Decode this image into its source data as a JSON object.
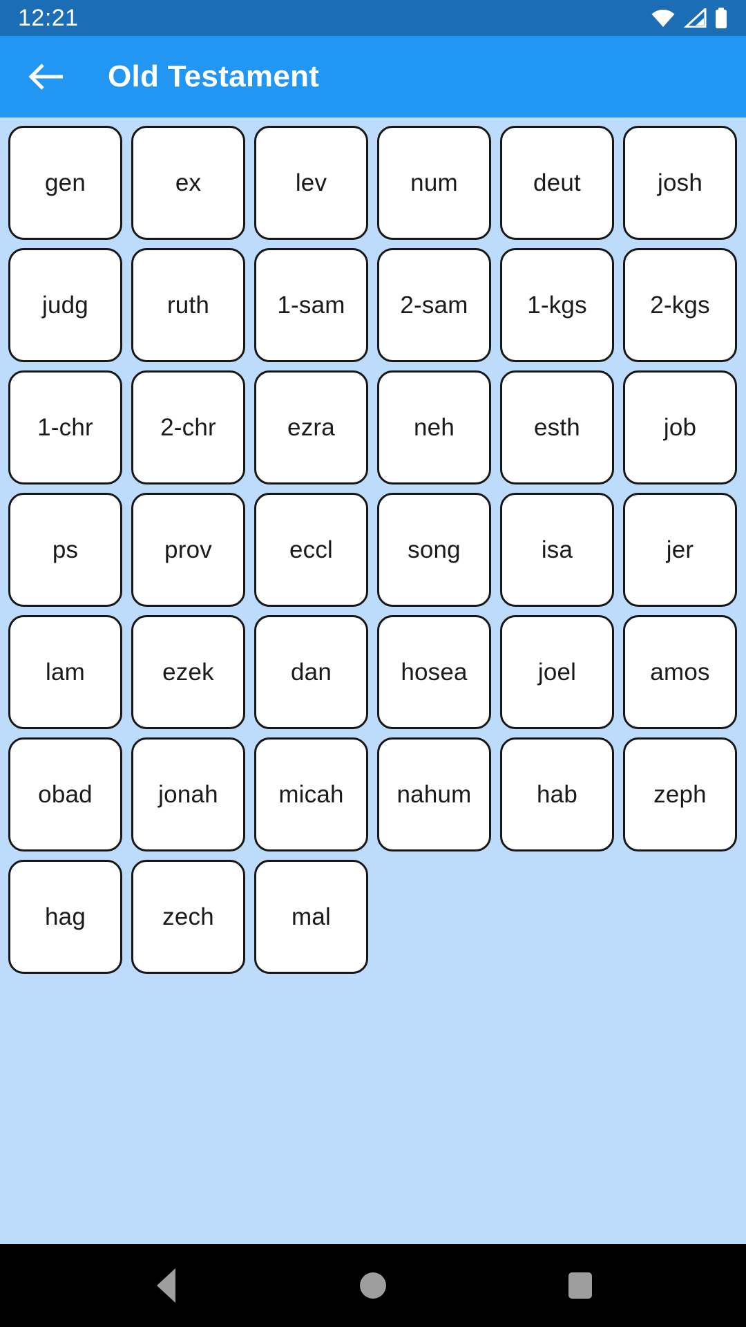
{
  "status_bar": {
    "time": "12:21",
    "icons": [
      "wifi-icon",
      "signal-icon",
      "battery-icon"
    ],
    "background_color": "#1b6db5"
  },
  "app_bar": {
    "back_icon": "arrow-left-icon",
    "title": "Old Testament",
    "background_color": "#2196f3",
    "text_color": "#ffffff"
  },
  "content": {
    "background_color": "#bddcfc",
    "columns": 6,
    "tile_style": {
      "background_color": "#ffffff",
      "border_color": "#171717",
      "text_color": "#1a1a1a"
    },
    "books": [
      "gen",
      "ex",
      "lev",
      "num",
      "deut",
      "josh",
      "judg",
      "ruth",
      "1-sam",
      "2-sam",
      "1-kgs",
      "2-kgs",
      "1-chr",
      "2-chr",
      "ezra",
      "neh",
      "esth",
      "job",
      "ps",
      "prov",
      "eccl",
      "song",
      "isa",
      "jer",
      "lam",
      "ezek",
      "dan",
      "hosea",
      "joel",
      "amos",
      "obad",
      "jonah",
      "micah",
      "nahum",
      "hab",
      "zeph",
      "hag",
      "zech",
      "mal"
    ]
  },
  "nav_bar": {
    "background_color": "#000000",
    "icon_color": "#9e9e9e",
    "buttons": [
      {
        "name": "back-triangle-icon"
      },
      {
        "name": "home-circle-icon"
      },
      {
        "name": "recents-square-icon"
      }
    ]
  }
}
